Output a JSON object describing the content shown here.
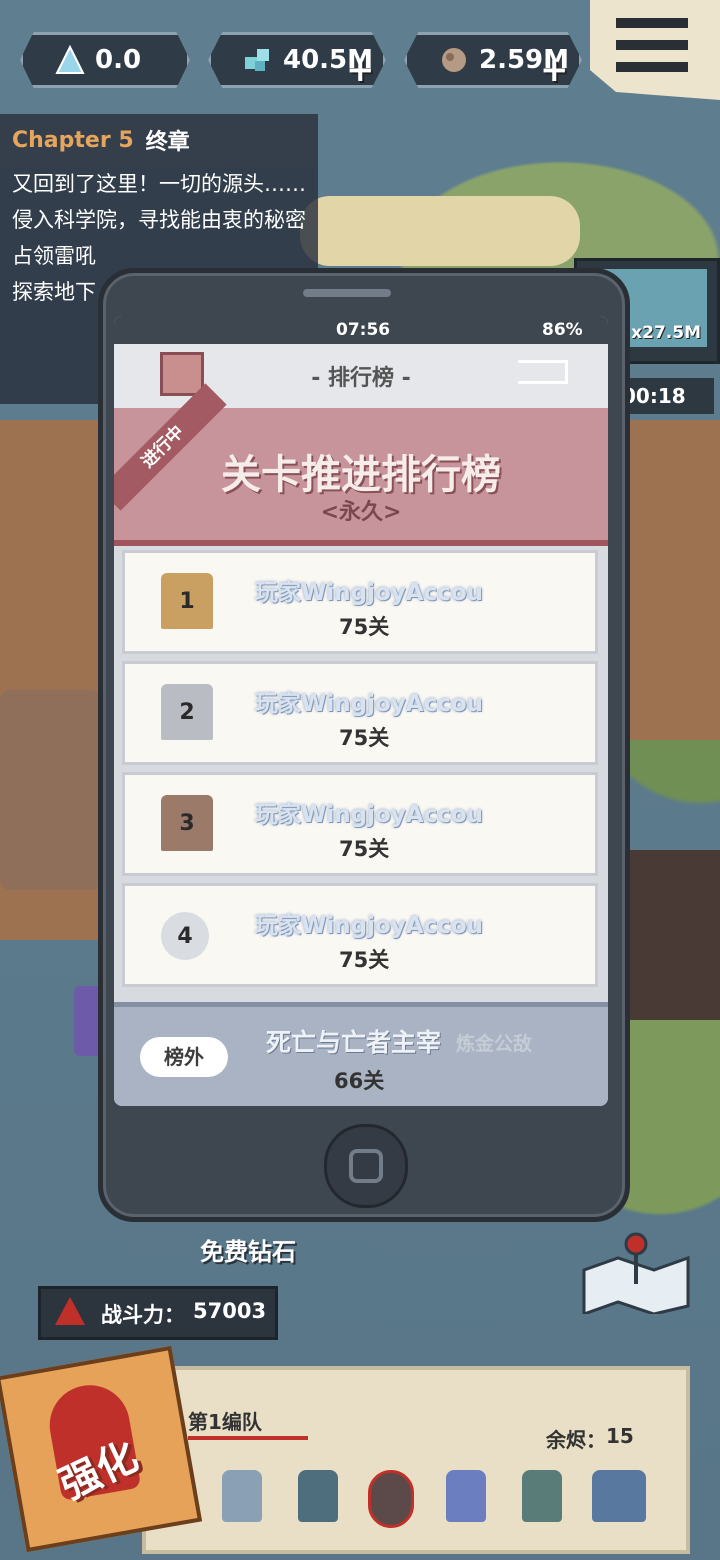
{
  "top_bar": {
    "res1": {
      "icon": "crystal-icon",
      "value": "0.0"
    },
    "res2": {
      "icon": "gem-cubes-icon",
      "value": "40.5M"
    },
    "res3": {
      "icon": "ore-icon",
      "value": "2.59M"
    },
    "plus": "+"
  },
  "chapter": {
    "label": "Chapter 5",
    "title": "终章",
    "quests": [
      "又回到了这里！一切的源头……",
      "侵入科学院，寻找能由衷的秘密",
      "占领雷吼",
      "探索地下"
    ]
  },
  "phone": {
    "time": "07:56",
    "battery": "86%",
    "title": "- 排行榜 -",
    "ribbon": "进行中",
    "board_title": "关卡推进排行榜",
    "board_sub": "<永久>",
    "rows": [
      {
        "rank": "1",
        "name": "玩家WingjoyAccou",
        "level": "75关"
      },
      {
        "rank": "2",
        "name": "玩家WingjoyAccou",
        "level": "75关"
      },
      {
        "rank": "3",
        "name": "玩家WingjoyAccou",
        "level": "75关"
      },
      {
        "rank": "4",
        "name": "玩家WingjoyAccou",
        "level": "75关"
      }
    ],
    "me": {
      "badge": "榜外",
      "name": "死亡与亡者主宰",
      "tag": "炼金公敌",
      "level": "66关"
    }
  },
  "right_panel": {
    "multiplier": "x27.5M",
    "timer": "00:18"
  },
  "bottom": {
    "free_gems": "免费钻石",
    "power_label": "战斗力：",
    "power_value": "57003",
    "enhance": "强化",
    "team_name": "第1编队",
    "remain_label": "余烬：",
    "remain_value": "15"
  },
  "colors": {
    "banner": "#c6949a",
    "accent": "#a35a62",
    "gold": "#c9a062",
    "silver": "#b9bcc2",
    "bronze": "#9c7a6a"
  }
}
